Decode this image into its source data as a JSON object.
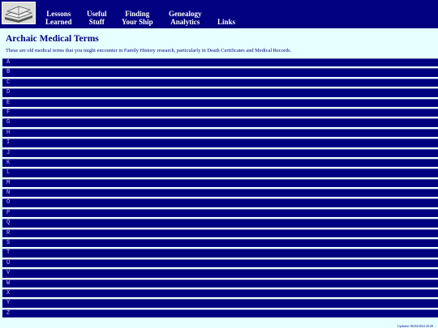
{
  "header": {
    "nav": [
      {
        "line1": "Lessons",
        "line2": "Learned"
      },
      {
        "line1": "Useful",
        "line2": "Stuff"
      },
      {
        "line1": "Finding",
        "line2": "Your Ship"
      },
      {
        "line1": "Genealogy",
        "line2": "Analytics"
      },
      {
        "line1": "Links",
        "line2": ""
      }
    ]
  },
  "main": {
    "title": "Archaic Medical Terms",
    "intro": "These are old medical terms that you might encounter in Family History research, particularly in Death Certificates and Medical Records.",
    "letters": [
      "A",
      "B",
      "C",
      "D",
      "E",
      "F",
      "G",
      "H",
      "I",
      "J",
      "K",
      "L",
      "M",
      "N",
      "O",
      "P",
      "Q",
      "R",
      "S",
      "T",
      "U",
      "V",
      "W",
      "X",
      "Y",
      "Z"
    ]
  },
  "footer": {
    "updated": "Updated: 06/04/2024 20:28"
  }
}
